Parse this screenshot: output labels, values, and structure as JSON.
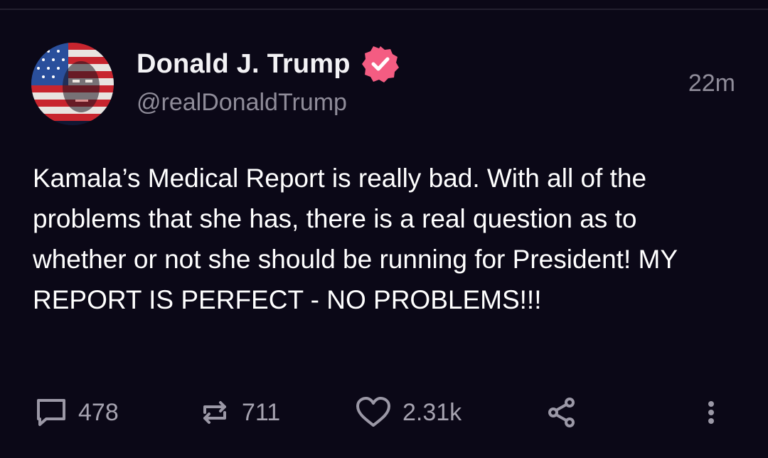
{
  "post": {
    "author_name": "Donald J. Trump",
    "author_handle": "@realDonaldTrump",
    "timestamp": "22m",
    "verified": true,
    "text": "Kamala’s Medical Report is really bad. With all of the problems that she has, there is a real question as to whether or not she should be running for President! MY REPORT IS PERFECT - NO PROBLEMS!!!"
  },
  "actions": {
    "reply_count": "478",
    "repost_count": "711",
    "like_count": "2.31k"
  },
  "colors": {
    "background": "#0b0817",
    "verified_badge": "#f45c82",
    "muted_text": "#8f8c99"
  },
  "icons": {
    "reply": "speech-bubble-icon",
    "repost": "repost-arrows-icon",
    "like": "heart-icon",
    "share": "share-nodes-icon",
    "more": "vertical-ellipsis-icon",
    "verified": "verified-badge-icon"
  }
}
